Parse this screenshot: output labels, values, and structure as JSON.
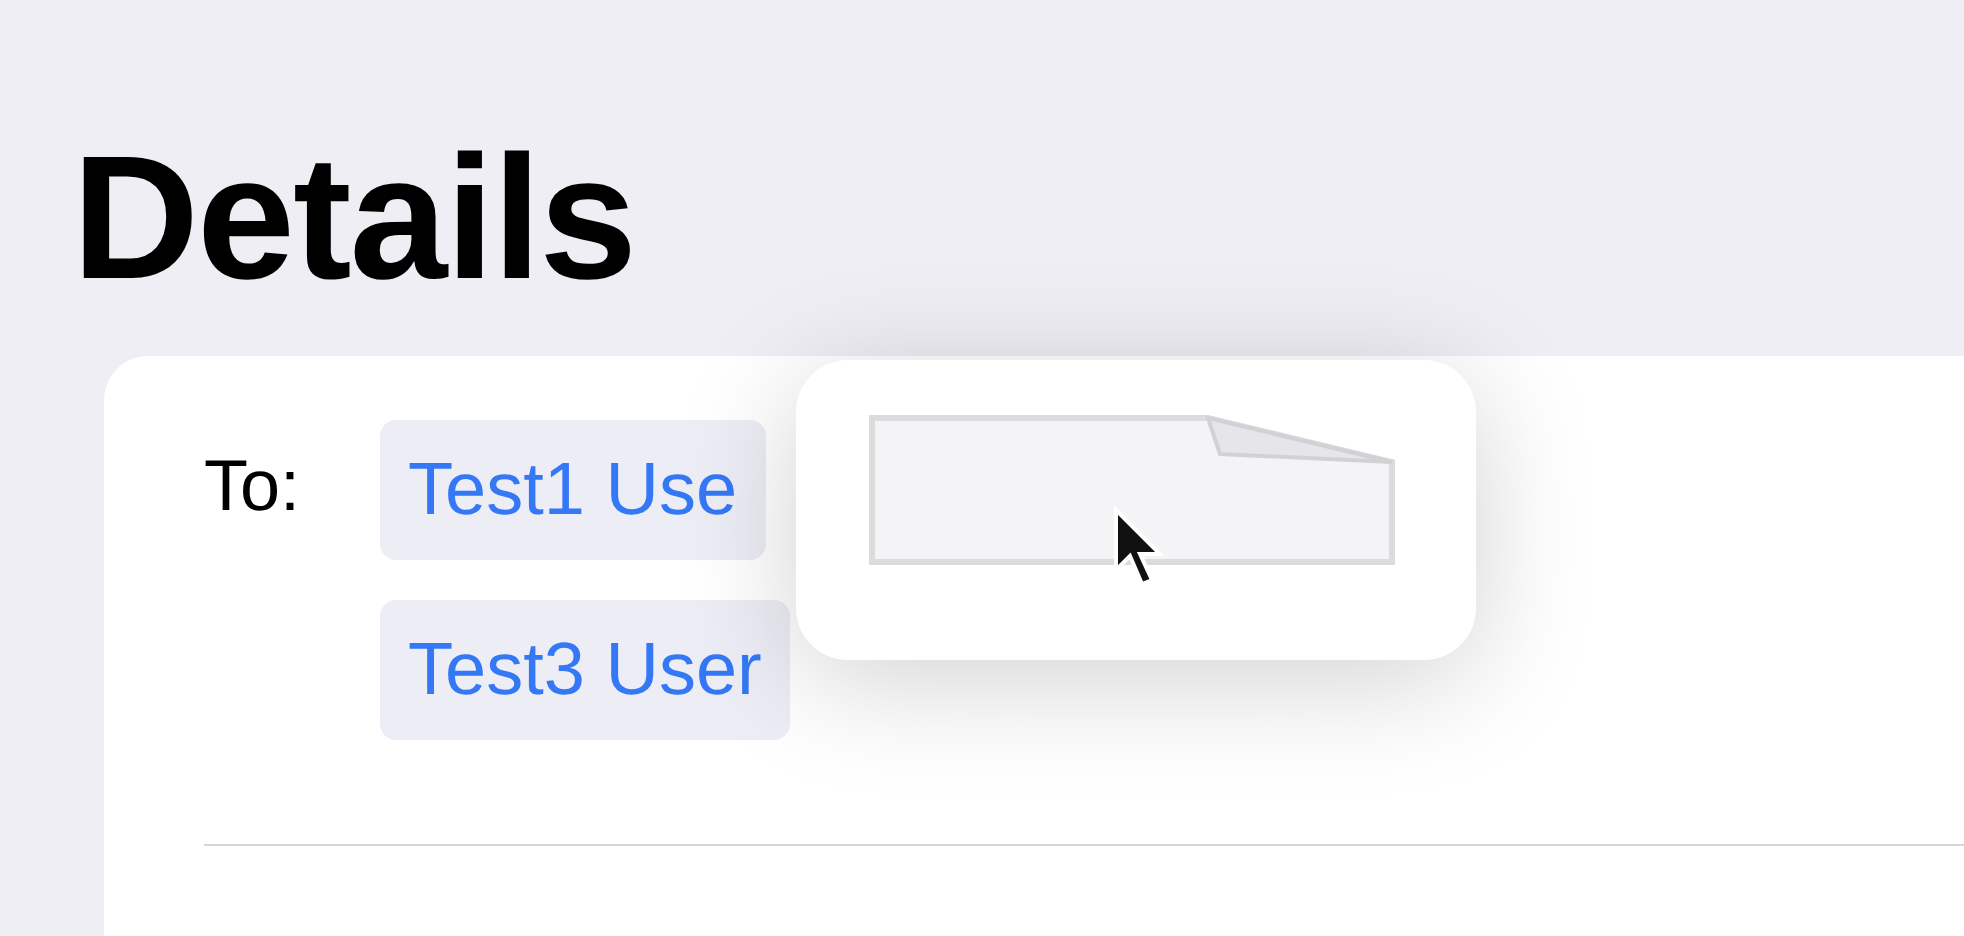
{
  "title": "Details",
  "recipients": {
    "label": "To:",
    "chips": [
      {
        "text": "Test1 Use"
      },
      {
        "text": "Test3 User"
      }
    ]
  }
}
